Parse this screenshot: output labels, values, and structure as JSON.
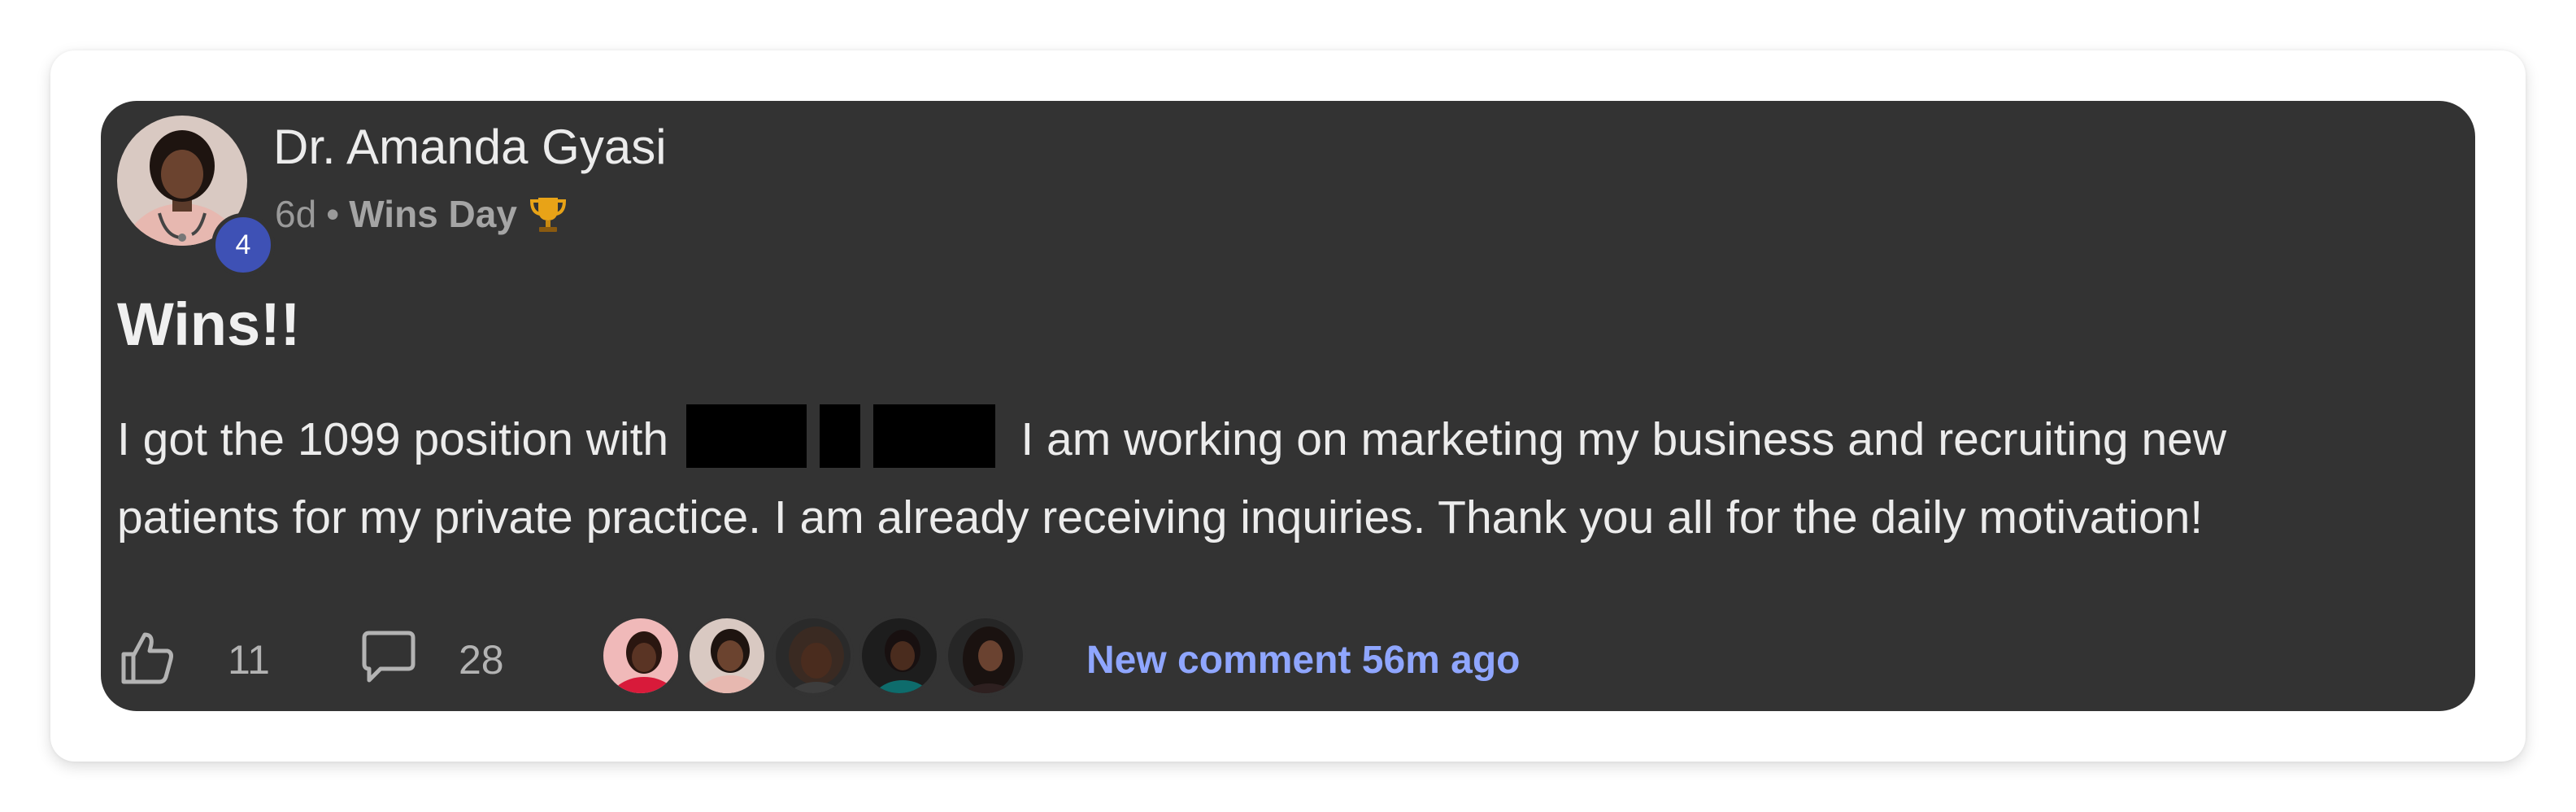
{
  "post": {
    "author_name": "Dr. Amanda Gyasi",
    "level": "4",
    "time_ago": "6d",
    "separator": "•",
    "category": "Wins Day",
    "category_icon": "trophy-icon",
    "title": "Wins!!",
    "body_line1_before": "I got the 1099 position with",
    "body_line1_after": "I am working on marketing my business and recruiting new",
    "body_line2": "patients for my private practice. I am already receiving inquiries. Thank you all for the daily motivation!"
  },
  "footer": {
    "like_icon": "thumbs-up-icon",
    "like_count": "11",
    "comment_icon": "comment-icon",
    "comment_count": "28",
    "commenter_avatars": [
      "commenter-avatar",
      "commenter-avatar",
      "commenter-avatar",
      "commenter-avatar",
      "commenter-avatar"
    ],
    "new_comment_text": "New comment 56m ago"
  },
  "colors": {
    "card_background": "#333333",
    "level_badge": "#3e51b5",
    "new_comment_link": "#8fa6ff",
    "text_primary": "#ececec",
    "text_muted": "#9a9a9a"
  }
}
